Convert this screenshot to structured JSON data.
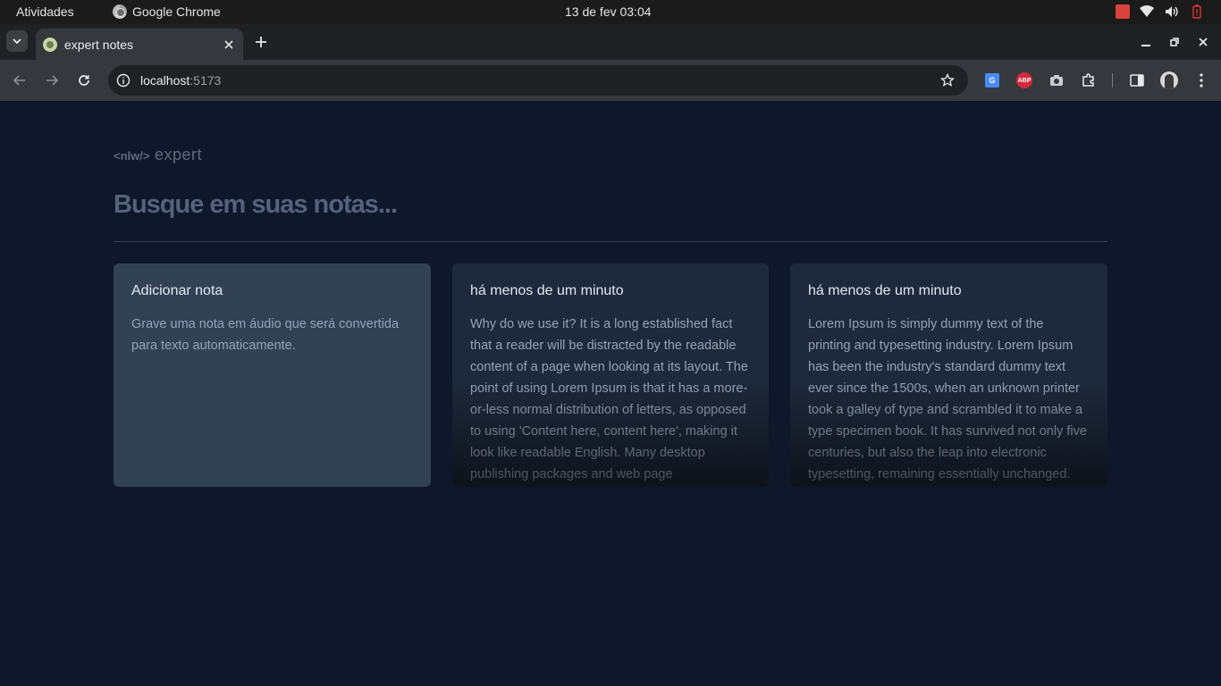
{
  "os": {
    "activities": "Atividades",
    "app_name": "Google Chrome",
    "clock": "13 de fev  03:04"
  },
  "browser": {
    "tab_title": "expert notes",
    "url_host": "localhost",
    "url_port": ":5173"
  },
  "app": {
    "logo_bracket": "<nlw/>",
    "logo_word": "expert",
    "search_placeholder": "Busque em suas notas...",
    "add_card": {
      "title": "Adicionar nota",
      "body": "Grave uma nota em áudio que será convertida para texto automaticamente."
    },
    "notes": [
      {
        "date": "há menos de um minuto",
        "content": "Why do we use it? It is a long established fact that a reader will be distracted by the readable content of a page when looking at its layout. The point of using Lorem Ipsum is that it has a more-or-less normal distribution of letters, as opposed to using 'Content here, content here', making it look like readable English. Many desktop publishing packages and web page"
      },
      {
        "date": "há menos de um minuto",
        "content": "Lorem Ipsum is simply dummy text of the printing and typesetting industry. Lorem Ipsum has been the industry's standard dummy text ever since the 1500s, when an unknown printer took a galley of type and scrambled it to make a type specimen book. It has survived not only five centuries, but also the leap into electronic typesetting, remaining essentially unchanged."
      }
    ]
  },
  "colors": {
    "background": "#0f172a",
    "add_card": "#334155",
    "note_card": "#1e293b",
    "placeholder": "#55627a"
  }
}
